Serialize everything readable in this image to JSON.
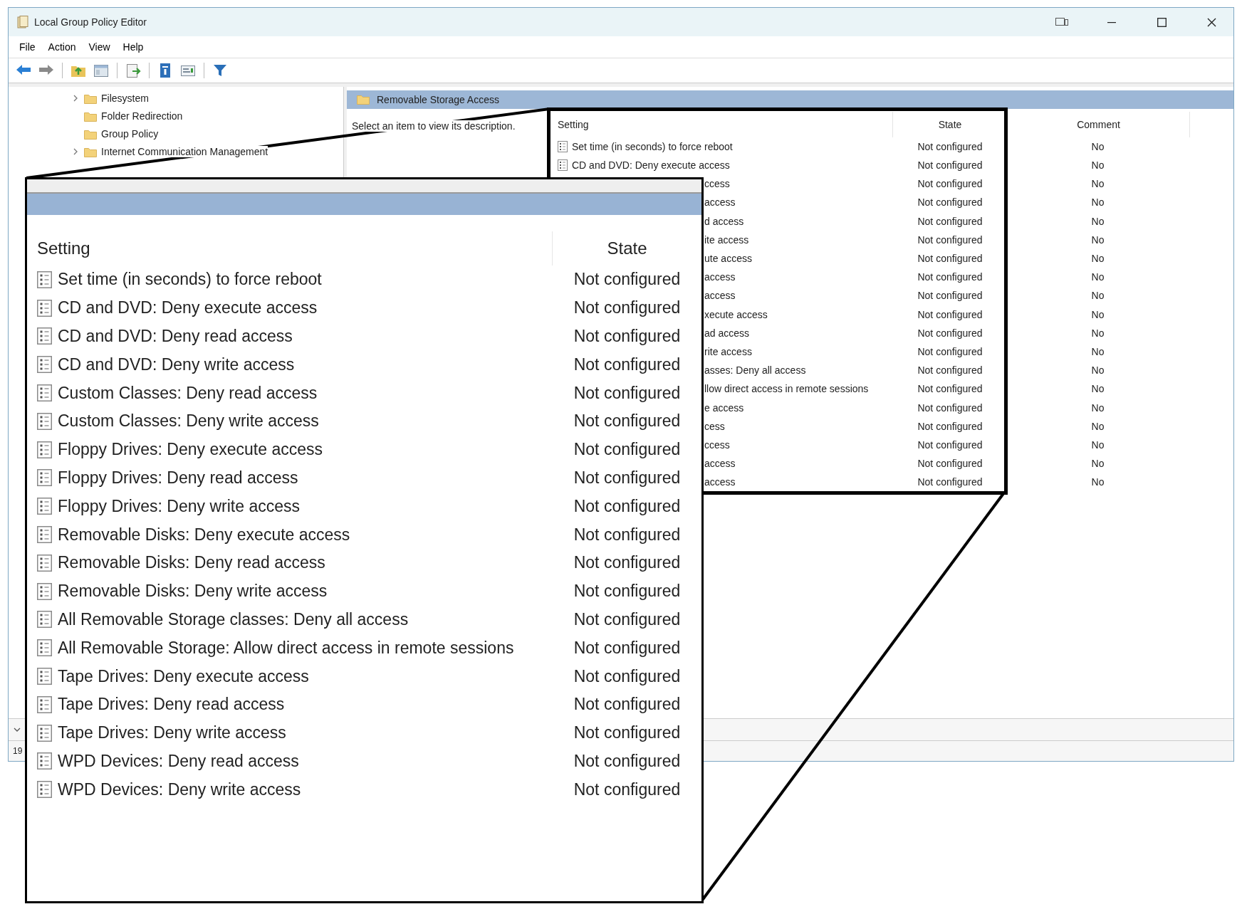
{
  "window": {
    "title": "Local Group Policy Editor"
  },
  "menu": [
    "File",
    "Action",
    "View",
    "Help"
  ],
  "tree": {
    "items": [
      {
        "label": "Filesystem",
        "expandable": true
      },
      {
        "label": "Folder Redirection",
        "expandable": false
      },
      {
        "label": "Group Policy",
        "expandable": false
      },
      {
        "label": "Internet Communication Management",
        "expandable": true
      }
    ]
  },
  "details": {
    "title": "Removable Storage Access",
    "description": "Select an item to view its description.",
    "columns": [
      "Setting",
      "State",
      "Comment"
    ],
    "rows": [
      {
        "kind": "full",
        "setting": "Set time (in seconds) to force reboot",
        "state": "Not configured",
        "comment": "No"
      },
      {
        "kind": "full",
        "setting": "CD and DVD: Deny execute access",
        "state": "Not configured",
        "comment": "No"
      },
      {
        "kind": "covered",
        "setting": "ccess",
        "state": "Not configured",
        "comment": "No"
      },
      {
        "kind": "covered",
        "setting": "access",
        "state": "Not configured",
        "comment": "No"
      },
      {
        "kind": "covered",
        "setting": "d access",
        "state": "Not configured",
        "comment": "No"
      },
      {
        "kind": "covered",
        "setting": "ite access",
        "state": "Not configured",
        "comment": "No"
      },
      {
        "kind": "covered",
        "setting": "ute access",
        "state": "Not configured",
        "comment": "No"
      },
      {
        "kind": "covered",
        "setting": "access",
        "state": "Not configured",
        "comment": "No"
      },
      {
        "kind": "covered",
        "setting": "access",
        "state": "Not configured",
        "comment": "No"
      },
      {
        "kind": "covered",
        "setting": "xecute access",
        "state": "Not configured",
        "comment": "No"
      },
      {
        "kind": "covered",
        "setting": "ad access",
        "state": "Not configured",
        "comment": "No"
      },
      {
        "kind": "covered",
        "setting": "rite access",
        "state": "Not configured",
        "comment": "No"
      },
      {
        "kind": "covered",
        "setting": "asses: Deny all access",
        "state": "Not configured",
        "comment": "No"
      },
      {
        "kind": "covered",
        "setting": "llow direct access in remote sessions",
        "state": "Not configured",
        "comment": "No"
      },
      {
        "kind": "covered",
        "setting": "e access",
        "state": "Not configured",
        "comment": "No"
      },
      {
        "kind": "covered",
        "setting": "cess",
        "state": "Not configured",
        "comment": "No"
      },
      {
        "kind": "covered",
        "setting": "ccess",
        "state": "Not configured",
        "comment": "No"
      },
      {
        "kind": "covered",
        "setting": "access",
        "state": "Not configured",
        "comment": "No"
      },
      {
        "kind": "covered",
        "setting": "access",
        "state": "Not configured",
        "comment": "No"
      }
    ]
  },
  "status_bar": {
    "text": "19"
  },
  "inset": {
    "columns": [
      "Setting",
      "State"
    ],
    "rows": [
      {
        "setting": "Set time (in seconds) to force reboot",
        "state": "Not configured"
      },
      {
        "setting": "CD and DVD: Deny execute access",
        "state": "Not configured"
      },
      {
        "setting": "CD and DVD: Deny read access",
        "state": "Not configured"
      },
      {
        "setting": "CD and DVD: Deny write access",
        "state": "Not configured"
      },
      {
        "setting": "Custom Classes: Deny read access",
        "state": "Not configured"
      },
      {
        "setting": "Custom Classes: Deny write access",
        "state": "Not configured"
      },
      {
        "setting": "Floppy Drives: Deny execute access",
        "state": "Not configured"
      },
      {
        "setting": "Floppy Drives: Deny read access",
        "state": "Not configured"
      },
      {
        "setting": "Floppy Drives: Deny write access",
        "state": "Not configured"
      },
      {
        "setting": "Removable Disks: Deny execute access",
        "state": "Not configured"
      },
      {
        "setting": "Removable Disks: Deny read access",
        "state": "Not configured"
      },
      {
        "setting": "Removable Disks: Deny write access",
        "state": "Not configured"
      },
      {
        "setting": "All Removable Storage classes: Deny all access",
        "state": "Not configured"
      },
      {
        "setting": "All Removable Storage: Allow direct access in remote sessions",
        "state": "Not configured"
      },
      {
        "setting": "Tape Drives: Deny execute access",
        "state": "Not configured"
      },
      {
        "setting": "Tape Drives: Deny read access",
        "state": "Not configured"
      },
      {
        "setting": "Tape Drives: Deny write access",
        "state": "Not configured"
      },
      {
        "setting": "WPD Devices: Deny read access",
        "state": "Not configured"
      },
      {
        "setting": "WPD Devices: Deny write access",
        "state": "Not configured"
      }
    ]
  }
}
